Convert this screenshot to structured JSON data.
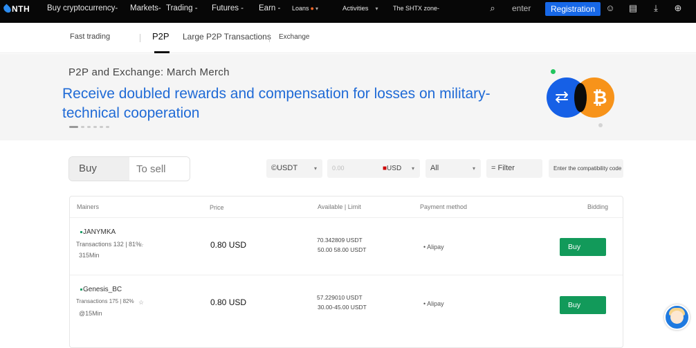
{
  "topnav": {
    "logo": "NTH",
    "items": [
      "Buy cryptocurrency-",
      "Markets-",
      "Trading -",
      "Futures -",
      "Earn -",
      "Loans",
      "Activities",
      "The SHTX zone-"
    ],
    "enter": "enter",
    "register": "Registration"
  },
  "subnav": {
    "fast": "Fast trading",
    "p2p": "P2P",
    "large": "Large P2P Transactions",
    "exchange": "Exchange"
  },
  "banner": {
    "subtitle": "P2P and Exchange: March Merch",
    "headline": "Receive doubled rewards and compensation for losses on military-technical cooperation"
  },
  "toggle": {
    "buy": "Buy",
    "sell": "To sell"
  },
  "filters": {
    "coin": "©USDT",
    "amount": "0.00",
    "currency": "USD",
    "payment": "All",
    "filter": "= Filter",
    "code": "Enter the compatibility code"
  },
  "table": {
    "headers": [
      "Mainers",
      "Price",
      "Available | Limit",
      "Payment method",
      "Bidding"
    ],
    "rows": [
      {
        "name": "JANYMKA",
        "trans": "Transactions 132 | 81%",
        "time": "315Min",
        "price": "0.80 USD",
        "avail": "70.342809 USDT",
        "limit": "50.00 58.00 USDT",
        "payment": "Alipay",
        "action": "Buy"
      },
      {
        "name": "Genesis_BC",
        "trans": "Transactions 175 | 82%",
        "time": "@15Min",
        "price": "0.80 USD",
        "avail": "57.229010 USDT",
        "limit": "30.00-45.00 USDT",
        "payment": "Alipay",
        "action": "Buy"
      }
    ]
  },
  "colors": {
    "accent": "#1768e8",
    "buy": "#129a5a",
    "headline": "#1f6ad6",
    "btc": "#f7931a"
  },
  "icons": [
    "search-icon",
    "user-avatar-icon",
    "orders-icon",
    "download-icon",
    "globe-icon",
    "swap-icon",
    "bitcoin-icon",
    "support-chat-icon",
    "chevron-down-icon",
    "star-icon"
  ]
}
